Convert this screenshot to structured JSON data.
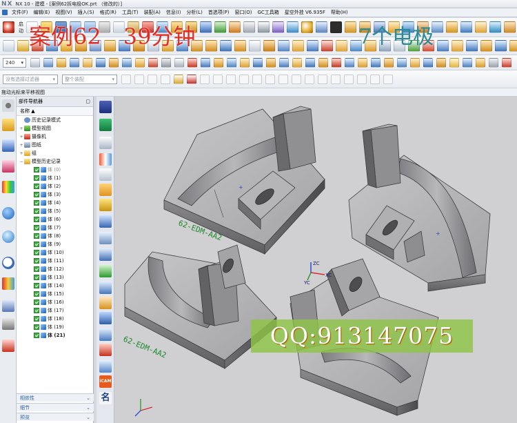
{
  "app": {
    "logo": "NX",
    "title": "NX 10 - 建模 - [案例62拆电极OK.prt （修改的）]"
  },
  "menu": [
    "文件(F)",
    "编辑(E)",
    "视图(V)",
    "插入(S)",
    "格式(R)",
    "工具(T)",
    "装配(A)",
    "信息(I)",
    "分析(L)",
    "首选项(P)",
    "窗口(O)",
    "GC工具箱",
    "星空外挂 V6.935F",
    "帮助(H)"
  ],
  "toolbar1": {
    "start_label": "启动"
  },
  "toolbar3": {
    "zoom_value": "240"
  },
  "toolbar4": {
    "filter_placeholder": "没有选择过滤器",
    "assembly_filter": "整个装配"
  },
  "overlays": {
    "case_label": "案例62　39分钟",
    "electrodes_label": "7个电极",
    "qq_label": "QQ:913147075"
  },
  "hint_bar": "拖动光标来平移视图",
  "navigator": {
    "title": "部件导航器",
    "column_header": "名称",
    "top_items": [
      "历史记录模式",
      "模型视图",
      "摄像机",
      "图纸",
      "组",
      "模型历史记录"
    ],
    "bodies": [
      "体 (0)",
      "体 (1)",
      "体 (2)",
      "体 (3)",
      "体 (4)",
      "体 (5)",
      "体 (6)",
      "体 (7)",
      "体 (8)",
      "体 (9)",
      "体 (10)",
      "体 (11)",
      "体 (12)",
      "体 (13)",
      "体 (14)",
      "体 (15)",
      "体 (16)",
      "体 (17)",
      "体 (18)",
      "体 (19)",
      "体 (21)"
    ],
    "footer": [
      "相依性",
      "细节",
      "预览"
    ]
  },
  "viewport": {
    "part_labels": [
      "62-EDM-AA2",
      "62-EDM-AA2"
    ],
    "triad": {
      "x": "XC",
      "y": "YC",
      "z": "ZC"
    }
  },
  "resource_bar": {
    "cam_label": "iCAM",
    "name_label": "名"
  },
  "colors": {
    "accent": "#2f6fc0",
    "overlay_red": "#e22b22",
    "model_gray": "#a9a9ab",
    "viewport_bg": "#d0d0d3"
  }
}
